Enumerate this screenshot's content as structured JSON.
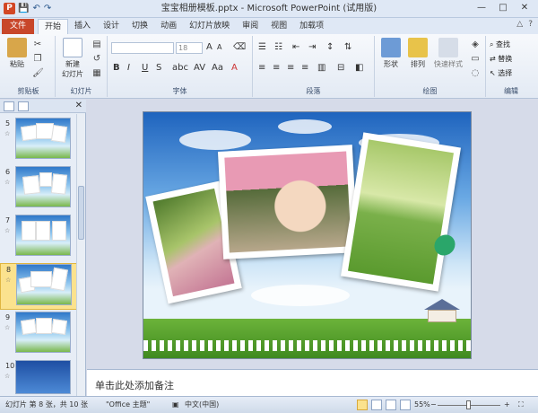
{
  "window": {
    "title": "宝宝相册模板.pptx - Microsoft PowerPoint (试用版)",
    "app_icon": "P",
    "controls": [
      "—",
      "□",
      "✕"
    ]
  },
  "qat": {
    "save_icon": "💾",
    "undo_icon": "↶",
    "redo_icon": "↷"
  },
  "tabs": {
    "file": "文件",
    "items": [
      "开始",
      "插入",
      "设计",
      "切换",
      "动画",
      "幻灯片放映",
      "审阅",
      "视图",
      "加载项"
    ],
    "active_index": 0,
    "right": [
      "△",
      "?"
    ]
  },
  "ribbon": {
    "clipboard": {
      "paste": "粘贴",
      "label": "剪贴板"
    },
    "slides": {
      "new_slide": "新建",
      "new_slide_line2": "幻灯片",
      "label": "幻灯片"
    },
    "font": {
      "font_size": "18",
      "label": "字体",
      "bold": "B",
      "italic": "I",
      "underline": "U",
      "strike": "S",
      "aa": "Aa"
    },
    "paragraph": {
      "label": "段落"
    },
    "drawing": {
      "shape": "形状",
      "arrange": "排列",
      "quick_style": "快速样式",
      "label": "绘图"
    },
    "editing": {
      "find": "查找",
      "replace": "替换",
      "select": "选择",
      "label": "编辑"
    }
  },
  "slide_panel": {
    "thumbs": [
      {
        "num": "5",
        "star": "☆"
      },
      {
        "num": "6",
        "star": "☆"
      },
      {
        "num": "7",
        "star": "☆"
      },
      {
        "num": "8",
        "star": "☆",
        "selected": true
      },
      {
        "num": "9",
        "star": "☆"
      },
      {
        "num": "10",
        "star": "☆"
      }
    ],
    "close": "✕"
  },
  "notes": {
    "placeholder": "单击此处添加备注"
  },
  "statusbar": {
    "slide_info": "幻灯片 第 8 张，共 10 张",
    "theme": "\"Office 主题\"",
    "language": "中文(中国)",
    "zoom": "55%",
    "zoom_minus": "−",
    "zoom_plus": "+"
  },
  "colors": {
    "file_tab": "#c8472a",
    "selected_thumb": "#fbe28e"
  }
}
